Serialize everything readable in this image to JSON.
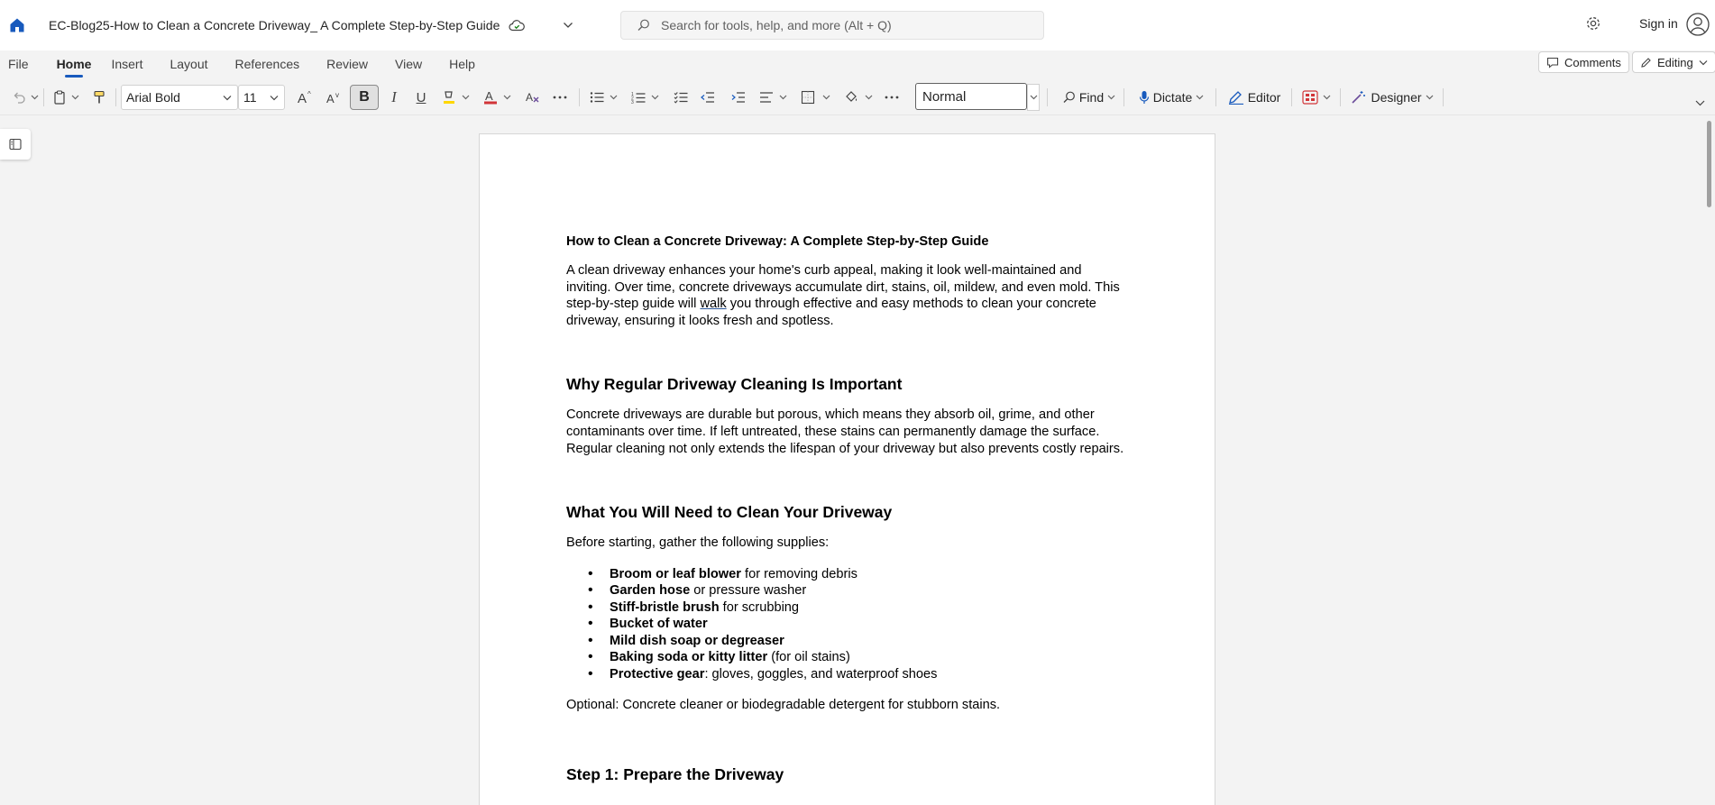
{
  "titlebar": {
    "doc_title": "EC-Blog25-How to Clean a Concrete Driveway_ A Complete Step-by-Step Guide",
    "search_placeholder": "Search for tools, help, and more (Alt + Q)",
    "signin_label": "Sign in"
  },
  "menubar": {
    "items": [
      "File",
      "Home",
      "Insert",
      "Layout",
      "References",
      "Review",
      "View",
      "Help"
    ],
    "active": "Home",
    "comments_label": "Comments",
    "editing_label": "Editing"
  },
  "ribbon": {
    "font_name": "Arial Bold",
    "font_size": "11",
    "style_name": "Normal",
    "find_label": "Find",
    "dictate_label": "Dictate",
    "editor_label": "Editor",
    "designer_label": "Designer",
    "bold_label": "B",
    "italic_label": "I",
    "underline_label": "U",
    "accent_color": "#185abd",
    "font_color_swatch": "#d13438",
    "highlight_swatch": "#ffd700"
  },
  "document": {
    "title": "How to Clean a Concrete Driveway: A Complete Step-by-Step Guide",
    "intro_before": "A clean driveway enhances your home's curb appeal, making it look well-maintained and inviting. Over time, concrete driveways accumulate dirt, stains, oil, mildew, and even mold. This step-by-step guide will ",
    "intro_walk": "walk",
    "intro_after": " you through effective and easy methods to clean your concrete driveway, ensuring it looks fresh and spotless.",
    "h2_why": "Why Regular Driveway Cleaning Is Important",
    "why_para": "Concrete driveways are durable but porous, which means they absorb oil, grime, and other contaminants over time. If left untreated, these stains can permanently damage the surface. Regular cleaning not only extends the lifespan of your driveway but also prevents costly repairs.",
    "h2_need": "What You Will Need to Clean Your Driveway",
    "need_intro": "Before starting, gather the following supplies:",
    "supplies": [
      {
        "bold": "Broom or leaf blower",
        "rest": " for removing debris"
      },
      {
        "bold": "Garden hose",
        "rest": " or pressure washer"
      },
      {
        "bold": "Stiff-bristle brush",
        "rest": " for scrubbing"
      },
      {
        "bold": "Bucket of water",
        "rest": ""
      },
      {
        "bold": "Mild dish soap or degreaser",
        "rest": ""
      },
      {
        "bold": "Baking soda or kitty litter",
        "rest": " (for oil stains)"
      },
      {
        "bold": "Protective gear",
        "rest": ": gloves, goggles, and waterproof shoes"
      }
    ],
    "optional": "Optional: Concrete cleaner or biodegradable detergent for stubborn stains.",
    "h2_step1": "Step 1: Prepare the Driveway"
  }
}
